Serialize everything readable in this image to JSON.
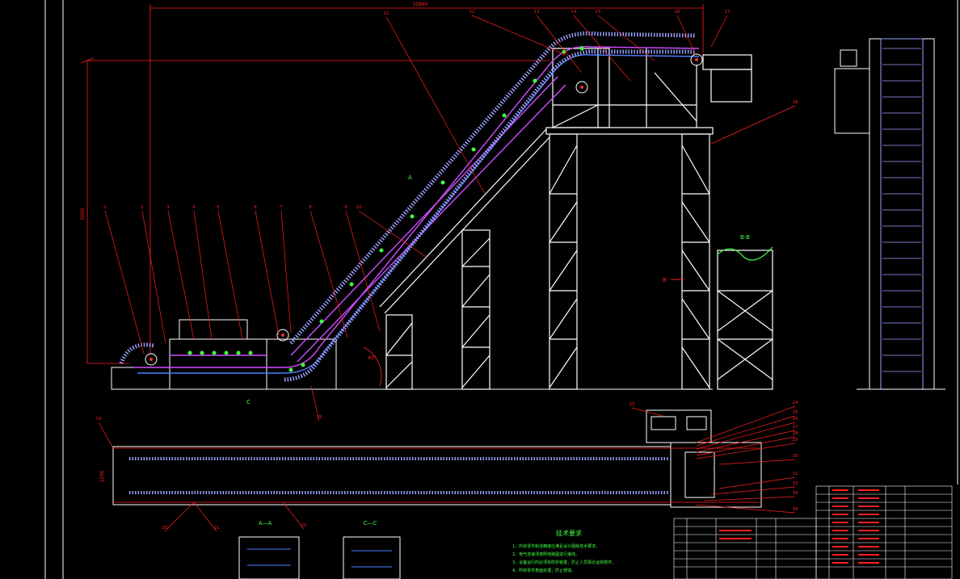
{
  "drawing": {
    "dim_overall_length": "10840",
    "dim_overall_height": "5000",
    "dim_belt_width": "1200",
    "angle_label": "40°",
    "section_aa": "A—A",
    "section_bb": "B-B",
    "section_cc": "C—C",
    "section_b_arrow": "B",
    "section_a_mark": "A",
    "section_c_mark": "C"
  },
  "balloons_top": [
    "1",
    "2",
    "3",
    "4",
    "5",
    "6",
    "7",
    "8",
    "9",
    "10",
    "11",
    "12",
    "13",
    "14",
    "15",
    "16",
    "17",
    "18"
  ],
  "balloons_bottom": [
    "19",
    "20",
    "21",
    "22",
    "23",
    "24",
    "25",
    "26",
    "27",
    "28",
    "29",
    "30",
    "31",
    "32",
    "33",
    "34",
    "35"
  ],
  "tech": {
    "title": "技术要求",
    "notes": [
      "1、所有零件制造精度应满足设计图纸技术要求。",
      "2、电气连接须按照电路图进行接线。",
      "3、设备运行时必须有防护装置，防止人员靠近运转部件。",
      "4、所有零件表面处理，防止锈蚀。"
    ]
  },
  "colors": {
    "frame": "#ffffff",
    "dimension": "#ff2020",
    "belt": "#d04dff",
    "belt_blue": "#4f7dff",
    "roller": "#40ff40",
    "note": "#40ff40"
  }
}
